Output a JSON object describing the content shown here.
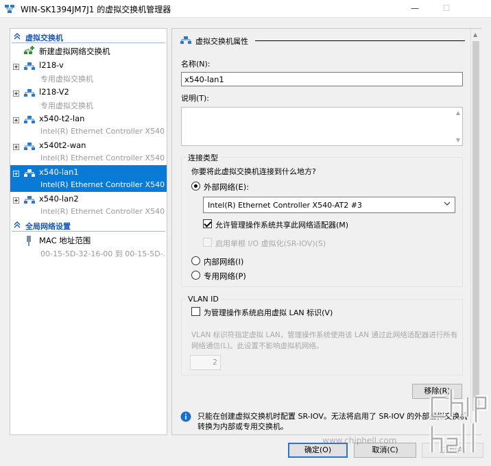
{
  "window": {
    "title": "WIN-SK1394JM7J1 的虚拟交换机管理器",
    "minimize": "—",
    "maximize": "☐"
  },
  "left": {
    "section_switches": "虚拟交换机",
    "new_switch": "新建虚拟网络交换机",
    "switches": [
      {
        "name": "l218-v",
        "sub": "专用虚拟交换机"
      },
      {
        "name": "l218-V2",
        "sub": "专用虚拟交换机"
      },
      {
        "name": "x540-t2-lan",
        "sub": "Intel(R) Ethernet Controller X540..."
      },
      {
        "name": "x540t2-wan",
        "sub": "Intel(R) Ethernet Controller X540..."
      },
      {
        "name": "x540-lan1",
        "sub": "Intel(R) Ethernet Controller X540..."
      },
      {
        "name": "x540-lan2",
        "sub": "Intel(R) Ethernet Controller X540..."
      }
    ],
    "selected_index": 4,
    "section_global": "全局网络设置",
    "mac_name": "MAC 地址范围",
    "mac_sub": "00-15-5D-32-16-00 到 00-15-5D-..."
  },
  "props": {
    "header": "虚拟交换机属性",
    "name_label": "名称(N):",
    "name_value": "x540-lan1",
    "notes_label": "说明(T):",
    "conn_type_title": "连接类型",
    "conn_question": "你要将此虚拟交换机连接到什么地方?",
    "external_label": "外部网络(E):",
    "adapter_value": "Intel(R) Ethernet Controller X540-AT2 #3",
    "allow_mgmt_label": "允许管理操作系统共享此网络适配器(M)",
    "sriov_label": "启用单根 I/O 虚拟化(SR-IOV)(S)",
    "internal_label": "内部网络(I)",
    "private_label": "专用网络(P)",
    "vlan_title": "VLAN ID",
    "vlan_check_label": "为管理操作系统启用虚拟 LAN 标识(V)",
    "vlan_desc": "VLAN 标识符指定虚拟 LAN，管理操作系统使用该 LAN 通过此网络适配器进行所有网络通信(L)。此设置不影响虚拟机网络。",
    "vlan_value": "2",
    "remove_label": "移除(R)",
    "info_text": "只能在创建虚拟交换机时配置 SR-IOV。无法将启用了 SR-IOV 的外部虚拟交换机转换为内部或专用交换机。"
  },
  "buttons": {
    "ok": "确定(O)",
    "cancel": "取消(C)",
    "apply": "应用(A)"
  },
  "watermark": "www.chiphell.com",
  "colors": {
    "selection": "#0a7ad7",
    "section_header": "#1a55b5",
    "primary_border": "#2c74c8"
  }
}
